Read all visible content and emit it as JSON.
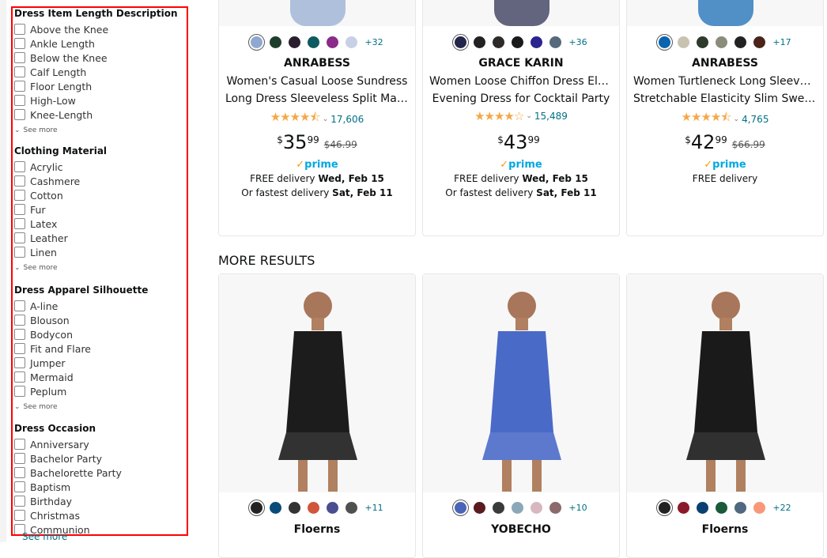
{
  "sidebar": {
    "groups": [
      {
        "heading": "Dress Item Length Description",
        "items": [
          "Above the Knee",
          "Ankle Length",
          "Below the Knee",
          "Calf Length",
          "Floor Length",
          "High-Low",
          "Knee-Length"
        ],
        "see_more": "See more"
      },
      {
        "heading": "Clothing Material",
        "items": [
          "Acrylic",
          "Cashmere",
          "Cotton",
          "Fur",
          "Latex",
          "Leather",
          "Linen"
        ],
        "see_more": "See more"
      },
      {
        "heading": "Dress Apparel Silhouette",
        "items": [
          "A-line",
          "Blouson",
          "Bodycon",
          "Fit and Flare",
          "Jumper",
          "Mermaid",
          "Peplum"
        ],
        "see_more": "See more"
      },
      {
        "heading": "Dress Occasion",
        "items": [
          "Anniversary",
          "Bachelor Party",
          "Bachelorette Party",
          "Baptism",
          "Birthday",
          "Christmas",
          "Communion"
        ],
        "see_more": "See more"
      }
    ]
  },
  "top_products": [
    {
      "swatches": [
        "#8fa8d0",
        "#1f3d2c",
        "#2a1e2e",
        "#0d5a60",
        "#8a2a8a",
        "#c8d0e8"
      ],
      "more_colors": "+32",
      "brand": "ANRABESS",
      "title1": "Women's Casual Loose Sundress",
      "title2": "Long Dress Sleeveless Split Maxi...",
      "stars": "★★★★⯪",
      "reviews": "17,606",
      "currency": "$",
      "price_whole": "35",
      "price_fraction": "99",
      "list_price": "$46.99",
      "prime": "prime",
      "delivery1_pre": "FREE delivery ",
      "delivery1_date": "Wed, Feb 15",
      "delivery2_pre": "Or fastest delivery ",
      "delivery2_date": "Sat, Feb 11"
    },
    {
      "swatches": [
        "#23254a",
        "#222222",
        "#2e2a28",
        "#1a1a1a",
        "#2a2490",
        "#566a7c"
      ],
      "more_colors": "+36",
      "brand": "GRACE KARIN",
      "title1": "Women Loose Chiffon Dress Elegant",
      "title2": "Evening Dress for Cocktail Party",
      "stars": "★★★★☆",
      "reviews": "15,489",
      "currency": "$",
      "price_whole": "43",
      "price_fraction": "99",
      "list_price": "",
      "prime": "prime",
      "delivery1_pre": "FREE delivery ",
      "delivery1_date": "Wed, Feb 15",
      "delivery2_pre": "Or fastest delivery ",
      "delivery2_date": "Sat, Feb 11"
    },
    {
      "swatches": [
        "#0a64b0",
        "#c8c2b0",
        "#2e3a2c",
        "#8c8c7c",
        "#222222",
        "#4a2418"
      ],
      "more_colors": "+17",
      "brand": "ANRABESS",
      "title1": "Women Turtleneck Long Sleeve Knit",
      "title2": "Stretchable Elasticity Slim Sweater...",
      "stars": "★★★★⯪",
      "reviews": "4,765",
      "currency": "$",
      "price_whole": "42",
      "price_fraction": "99",
      "list_price": "$66.99",
      "prime": "prime",
      "delivery1_pre": "FREE delivery",
      "delivery1_date": "",
      "delivery2_pre": "",
      "delivery2_date": ""
    }
  ],
  "more_results_heading": "MORE RESULTS",
  "more_products": [
    {
      "swatches": [
        "#222222",
        "#0a4a78",
        "#333333",
        "#d0553a",
        "#4a4e90",
        "#505050"
      ],
      "more_colors": "+11",
      "brand": "Floerns",
      "dress_color": "#1c1c1c"
    },
    {
      "swatches": [
        "#4a64b8",
        "#5a1a20",
        "#3a3a3a",
        "#8aa8b8",
        "#d8b8c0",
        "#8a6a6a"
      ],
      "more_colors": "+10",
      "brand": "YOBECHO",
      "dress_color": "#4a6ac8"
    },
    {
      "swatches": [
        "#222222",
        "#8a1a2a",
        "#0a4070",
        "#1a5a3a",
        "#506880",
        "#f89878"
      ],
      "more_colors": "+22",
      "brand": "Floerns",
      "dress_color": "#1a1a1a"
    }
  ]
}
